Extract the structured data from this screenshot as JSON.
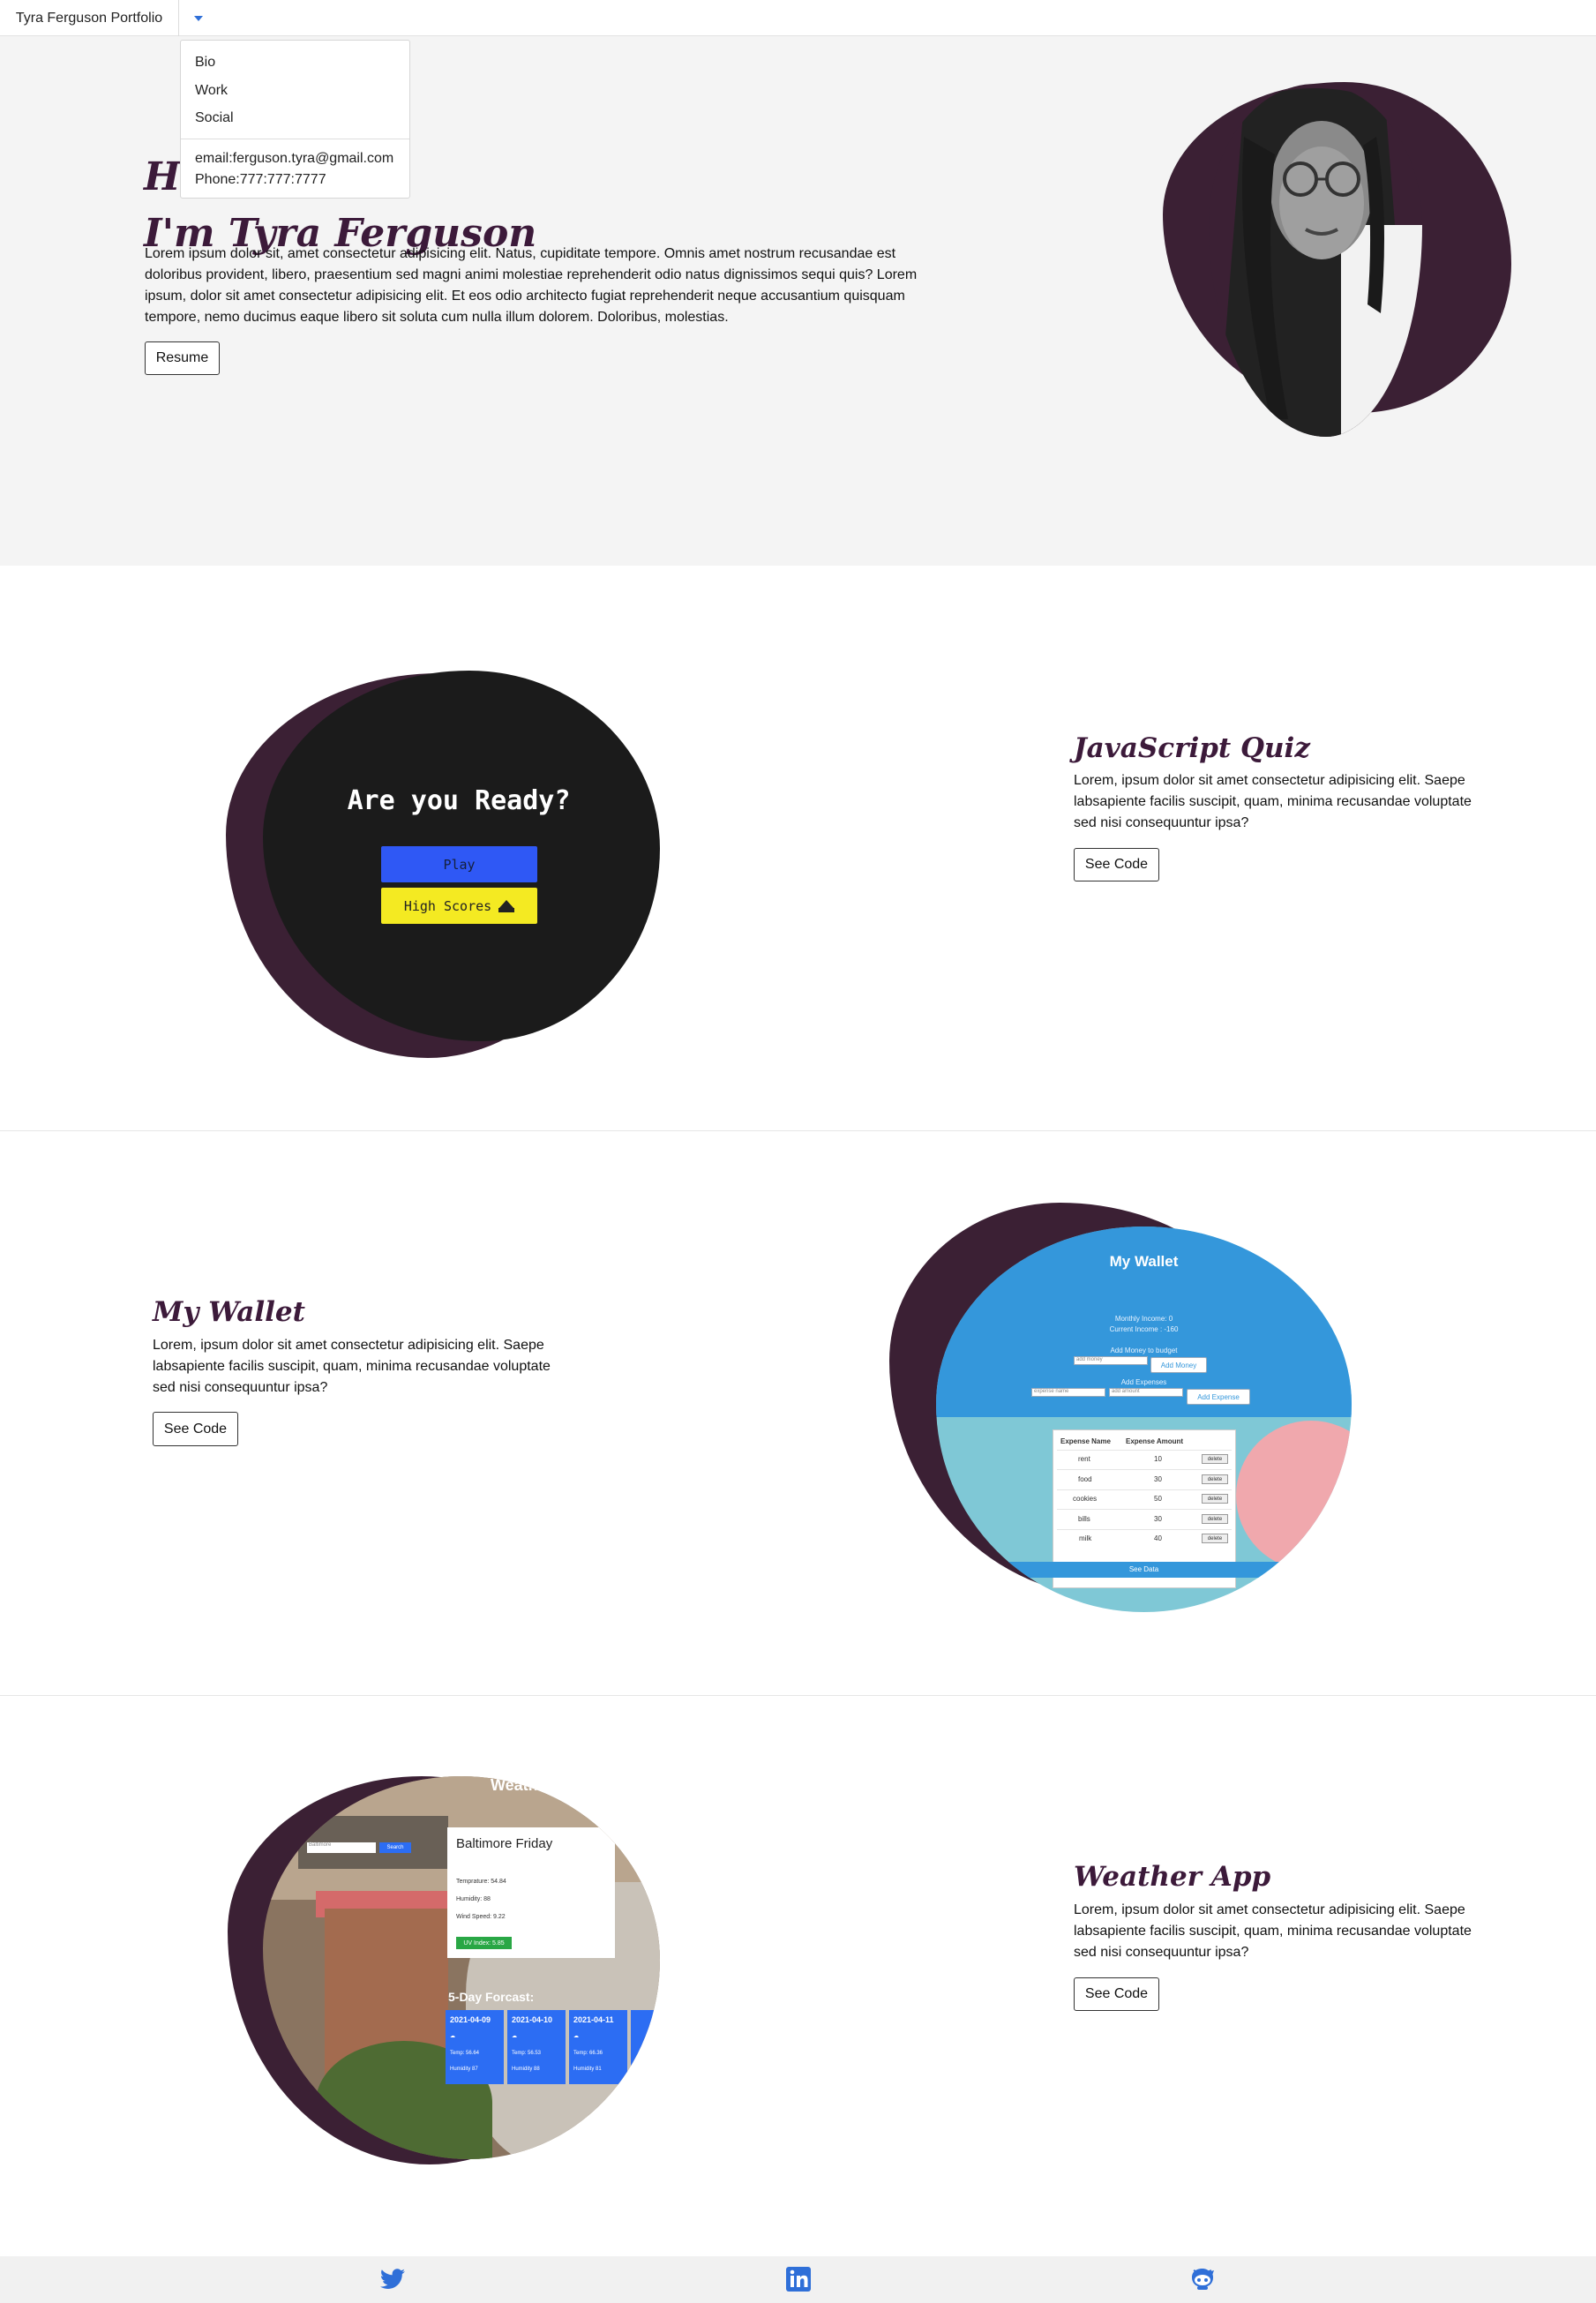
{
  "navbar": {
    "brand": "Tyra Ferguson Portfolio",
    "menu": {
      "items": [
        "Bio",
        "Work",
        "Social"
      ],
      "email": "email:ferguson.tyra@gmail.com",
      "phone": "Phone:777:777:7777"
    }
  },
  "hero": {
    "greeting": "Hello,",
    "name_line": "I'm Tyra Ferguson",
    "text": "Lorem ipsum dolor sit, amet consectetur adipisicing elit. Natus, cupiditate tempore. Omnis amet nostrum recusandae est doloribus provident, libero, praesentium sed magni animi molestiae reprehenderit odio natus dignissimos sequi quis? Lorem ipsum, dolor sit amet consectetur adipisicing elit. Et eos odio architecto fugiat reprehenderit neque accusantium quisquam tempore, nemo ducimus eaque libero sit soluta cum nulla illum dolorem. Doloribus, molestias.",
    "resume_button": "Resume"
  },
  "projects": [
    {
      "title": "JavaScript Quiz",
      "description": "Lorem, ipsum dolor sit amet consectetur adipisicing elit. Saepe labsapiente facilis suscipit, quam, minima recusandae voluptate sed nisi consequuntur ipsa?",
      "button": "See Code",
      "preview": {
        "heading": "Are you Ready?",
        "play": "Play",
        "high_scores": "High Scores"
      }
    },
    {
      "title": "My Wallet",
      "description": "Lorem, ipsum dolor sit amet consectetur adipisicing elit. Saepe labsapiente facilis suscipit, quam, minima recusandae voluptate sed nisi consequuntur ipsa?",
      "button": "See Code",
      "preview": {
        "heading": "My Wallet",
        "monthly_income": "Monthly Income: 0",
        "current_income": "Current Income : -160",
        "add_money_label": "Add Money to budget",
        "add_money_placeholder": "add money",
        "add_money_button": "Add Money",
        "add_expenses_label": "Add Expenses",
        "expense_name_placeholder": "expense name",
        "amount_placeholder": "add amount",
        "add_expense_button": "Add Expense",
        "col_name": "Expense Name",
        "col_amount": "Expense Amount",
        "rows": [
          {
            "name": "rent",
            "amount": "10"
          },
          {
            "name": "food",
            "amount": "30"
          },
          {
            "name": "cookies",
            "amount": "50"
          },
          {
            "name": "bills",
            "amount": "30"
          },
          {
            "name": "milk",
            "amount": "40"
          }
        ],
        "delete": "delete",
        "see_data": "See Data"
      }
    },
    {
      "title": "Weather App",
      "description": "Lorem, ipsum dolor sit amet consectetur adipisicing elit. Saepe labsapiente facilis suscipit, quam, minima recusandae voluptate sed nisi consequuntur ipsa?",
      "button": "See Code",
      "preview": {
        "header": "Weath",
        "search_label": "y:",
        "search_placeholder": "Baltimore",
        "search_button": "Search",
        "city_title": "Baltimore Friday",
        "temperature": "Temprature: 54.84",
        "humidity": "Humidity: 88",
        "wind": "Wind Speed: 9.22",
        "uv": "UV Index: 5.85",
        "forecast_title": "5-Day Forcast:",
        "forecast": [
          {
            "date": "2021-04-09",
            "temp": "Temp: 56.64",
            "hum": "Humidity 87"
          },
          {
            "date": "2021-04-10",
            "temp": "Temp: 56.53",
            "hum": "Humidity 88"
          },
          {
            "date": "2021-04-11",
            "temp": "Temp: 66.36",
            "hum": "Humidity 81"
          }
        ]
      }
    }
  ],
  "footer": {
    "icons": [
      "twitter-icon",
      "linkedin-icon",
      "github-icon"
    ]
  },
  "colors": {
    "accent": "#3c1a3a",
    "blob": "#3b2034",
    "hero_bg": "#f4f4f4",
    "link_blue": "#2f6fd8"
  }
}
